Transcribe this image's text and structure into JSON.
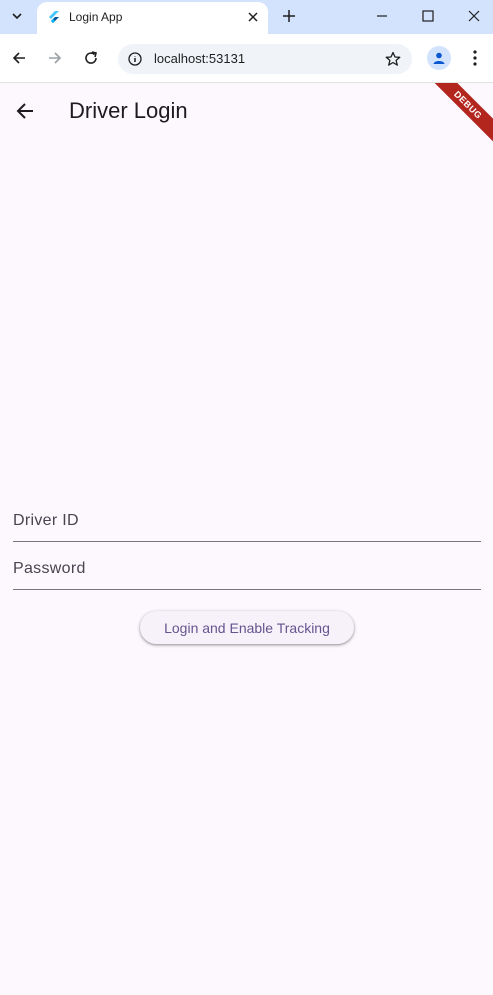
{
  "browser": {
    "tab_title": "Login App",
    "url": "localhost:53131"
  },
  "app": {
    "title": "Driver Login",
    "debug_label": "DEBUG",
    "driver_id_placeholder": "Driver ID",
    "password_placeholder": "Password",
    "login_button": "Login and Enable Tracking"
  },
  "colors": {
    "background": "#fdf7fe",
    "accent": "#65558f",
    "tabstrip": "#d3e3fd",
    "debug_banner": "#b3261e"
  }
}
